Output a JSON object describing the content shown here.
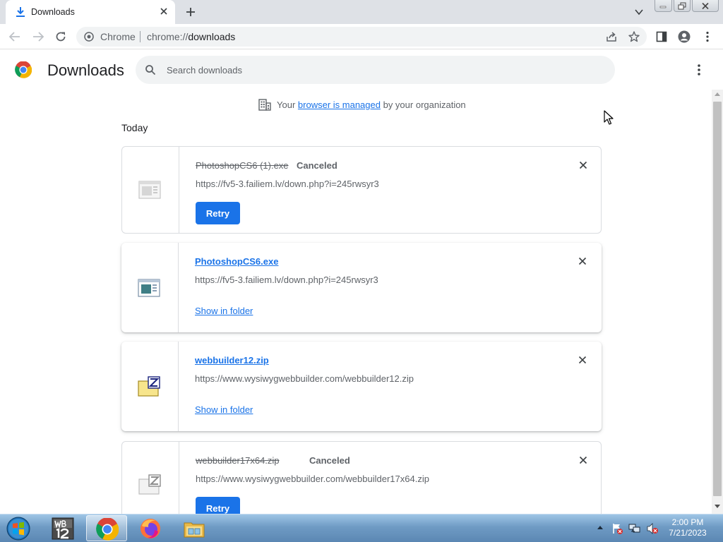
{
  "browser": {
    "tab_title": "Downloads",
    "omnibox_site_label": "Chrome",
    "omnibox_url_protocol": "chrome://",
    "omnibox_url_path": "downloads"
  },
  "page": {
    "title": "Downloads",
    "search_placeholder": "Search downloads",
    "managed_notice": {
      "prefix": "Your",
      "link": "browser is managed",
      "suffix": "by your organization"
    },
    "section_label": "Today"
  },
  "downloads": [
    {
      "file_name": "PhotoshopCS6 (1).exe",
      "state": "Canceled",
      "url": "https://fv5-3.failiem.lv/down.php?i=245rwsyr3",
      "action": "Retry",
      "icon": "exe-file-icon"
    },
    {
      "file_name": "PhotoshopCS6.exe",
      "state": "",
      "url": "https://fv5-3.failiem.lv/down.php?i=245rwsyr3",
      "action": "Show in folder",
      "icon": "exe-file-icon"
    },
    {
      "file_name": "webbuilder12.zip",
      "state": "",
      "url": "https://www.wysiwygwebbuilder.com/webbuilder12.zip",
      "action": "Show in folder",
      "icon": "zip-file-icon"
    },
    {
      "file_name": "webbuilder17x64.zip",
      "state": "Canceled",
      "url": "https://www.wysiwygwebbuilder.com/webbuilder17x64.zip",
      "action": "Retry",
      "icon": "zip-file-icon"
    }
  ],
  "taskbar": {
    "items": [
      "start-orb-icon",
      "webbuilder-12-icon",
      "chrome-icon",
      "firefox-icon",
      "file-explorer-icon"
    ],
    "clock_time": "2:00 PM",
    "clock_date": "7/21/2023"
  },
  "colors": {
    "accent": "#1a73e8",
    "tab_strip": "#dee1e6",
    "secondary_text": "#5f6368"
  }
}
